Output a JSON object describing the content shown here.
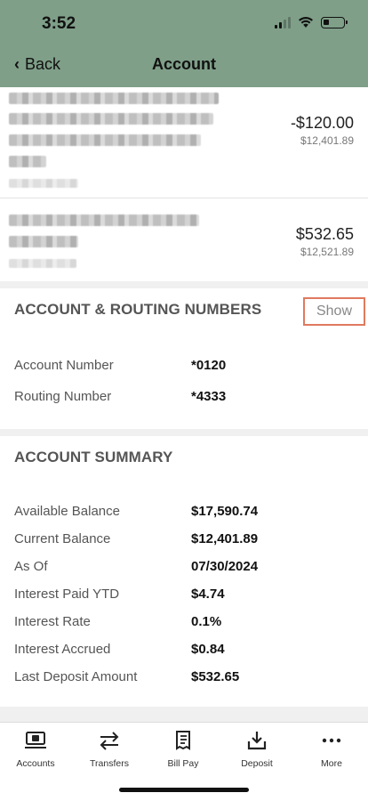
{
  "status": {
    "time": "3:52"
  },
  "nav": {
    "back_label": "Back",
    "title": "Account"
  },
  "transactions": [
    {
      "amount": "-$120.00",
      "balance": "$12,401.89"
    },
    {
      "amount": "$532.65",
      "balance": "$12,521.89"
    }
  ],
  "routing": {
    "title": "ACCOUNT & ROUTING NUMBERS",
    "show_label": "Show",
    "rows": [
      {
        "label": "Account Number",
        "value": "*0120"
      },
      {
        "label": "Routing Number",
        "value": "*4333"
      }
    ]
  },
  "summary": {
    "title": "ACCOUNT SUMMARY",
    "rows": [
      {
        "label": "Available Balance",
        "value": "$17,590.74"
      },
      {
        "label": "Current Balance",
        "value": "$12,401.89"
      },
      {
        "label": "As Of",
        "value": "07/30/2024"
      },
      {
        "label": "Interest Paid YTD",
        "value": "$4.74"
      },
      {
        "label": "Interest Rate",
        "value": "0.1%"
      },
      {
        "label": "Interest Accrued",
        "value": "$0.84"
      },
      {
        "label": "Last Deposit Amount",
        "value": "$532.65"
      }
    ]
  },
  "tabbar": {
    "items": [
      {
        "label": "Accounts",
        "icon": "accounts-icon"
      },
      {
        "label": "Transfers",
        "icon": "transfers-icon"
      },
      {
        "label": "Bill Pay",
        "icon": "bill-pay-icon"
      },
      {
        "label": "Deposit",
        "icon": "deposit-icon"
      },
      {
        "label": "More",
        "icon": "more-icon"
      }
    ]
  },
  "colors": {
    "header_bg": "#7f9f88",
    "show_border": "#e07a5f"
  }
}
